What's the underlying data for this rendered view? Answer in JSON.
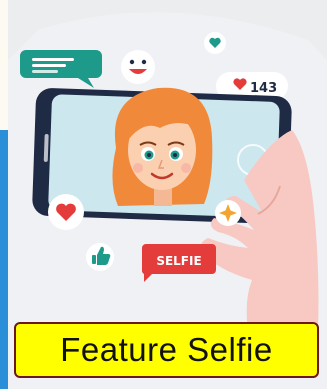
{
  "illustration": {
    "likes_count": "143",
    "selfie_tag": "SELFIE",
    "colors": {
      "teal": "#1e9a8a",
      "red": "#e43b3b",
      "phone_body": "#1f2a44",
      "hair": "#f08a3a",
      "skin": "#fbd0b0",
      "screen_bg": "#cde7ef"
    }
  },
  "caption": {
    "text": "Feature Selfie"
  }
}
